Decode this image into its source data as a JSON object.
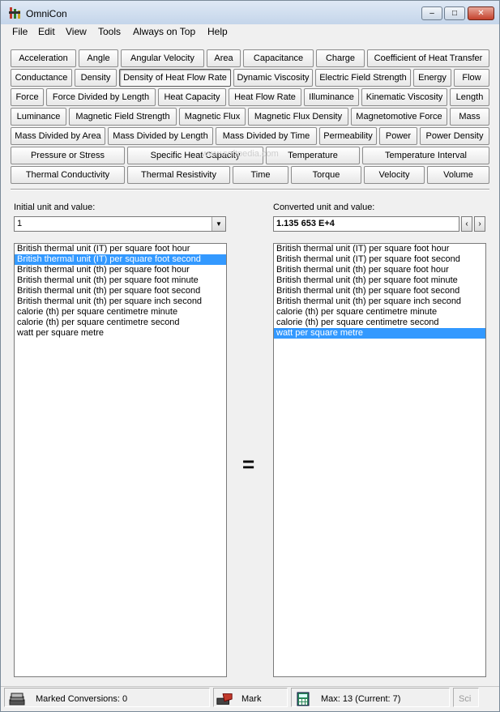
{
  "window": {
    "title": "OmniCon"
  },
  "menu": [
    "File",
    "Edit",
    "View",
    "Tools",
    "Always on Top",
    "Help"
  ],
  "categories": [
    "Acceleration",
    "Angle",
    "Angular Velocity",
    "Area",
    "Capacitance",
    "Charge",
    "Coefficient of Heat Transfer",
    "Conductance",
    "Density",
    "Density of Heat Flow Rate",
    "Dynamic Viscosity",
    "Electric Field Strength",
    "Energy",
    "Flow",
    "Force",
    "Force Divided by Length",
    "Heat Capacity",
    "Heat Flow Rate",
    "Illuminance",
    "Kinematic Viscosity",
    "Length",
    "Luminance",
    "Magnetic Field Strength",
    "Magnetic Flux",
    "Magnetic Flux Density",
    "Magnetomotive Force",
    "Mass",
    "Mass Divided by Area",
    "Mass Divided by Length",
    "Mass Divided by Time",
    "Permeability",
    "Power",
    "Power Density",
    "Pressure or Stress",
    "Specific Heat Capacity",
    "Temperature",
    "Temperature Interval",
    "Thermal Conductivity",
    "Thermal Resistivity",
    "Time",
    "Torque",
    "Velocity",
    "Volume"
  ],
  "active_category": "Density of Heat Flow Rate",
  "input": {
    "label": "Initial unit and value:",
    "value": "1",
    "selected_index": 1
  },
  "output": {
    "label": "Converted unit and value:",
    "value": "1.135 653 E+4",
    "selected_index": 8
  },
  "units": [
    "British thermal unit (IT) per square foot hour",
    "British thermal unit (IT) per square foot second",
    "British thermal unit (th) per square foot hour",
    "British thermal unit (th) per square foot minute",
    "British thermal unit (th) per square foot second",
    "British thermal unit (th) per square inch second",
    "calorie (th) per square centimetre minute",
    "calorie (th) per square centimetre second",
    "watt per square metre"
  ],
  "equals_sign": "=",
  "watermark": "www.softpedia.com",
  "status": {
    "marked": "Marked Conversions: 0",
    "mark_label": "Mark",
    "max": "Max: 13 (Current: 7)",
    "sci": "Sci"
  },
  "colors": {
    "selection": "#3399ff",
    "face": "#f0f0f0"
  }
}
